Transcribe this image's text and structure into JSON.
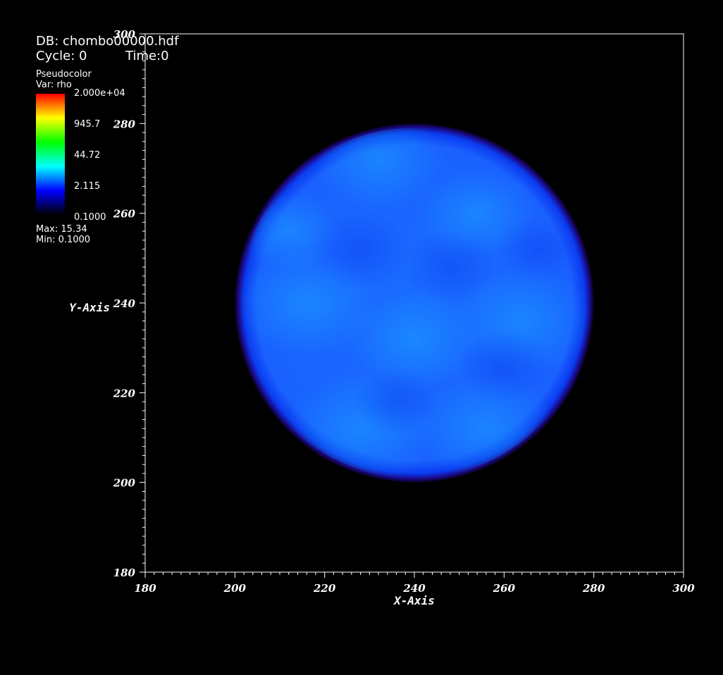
{
  "header": {
    "db": "DB: chombo00000.hdf",
    "cycle": "Cycle: 0",
    "time": "Time:0"
  },
  "legend": {
    "plot_type": "Pseudocolor",
    "var": "Var: rho",
    "labels": [
      "2.000e+04",
      "945.7",
      "44.72",
      "2.115",
      "0.1000"
    ],
    "max": "Max:  15.34",
    "min": "Min:  0.1000",
    "colors": [
      "#ff0000",
      "#ffff00",
      "#00ff00",
      "#00ffff",
      "#0000ff",
      "#000000"
    ]
  },
  "chart_data": {
    "type": "heatmap",
    "title": "",
    "xlabel": "X-Axis",
    "ylabel": "Y-Axis",
    "xlim": [
      180,
      300
    ],
    "ylim": [
      180,
      300
    ],
    "x_ticks": [
      180,
      200,
      220,
      240,
      260,
      280,
      300
    ],
    "y_ticks": [
      180,
      200,
      220,
      240,
      260,
      280,
      300
    ],
    "x_tick_labels": [
      "180",
      "200",
      "220",
      "240",
      "260",
      "280",
      "300"
    ],
    "y_tick_labels": [
      "180",
      "200",
      "220",
      "240",
      "260",
      "280",
      "300"
    ],
    "field": {
      "shape": "disk",
      "center": [
        240,
        240
      ],
      "radius": 40,
      "value_range": [
        0.1,
        15.34
      ],
      "color": "#1a60ff"
    },
    "grid": false
  }
}
